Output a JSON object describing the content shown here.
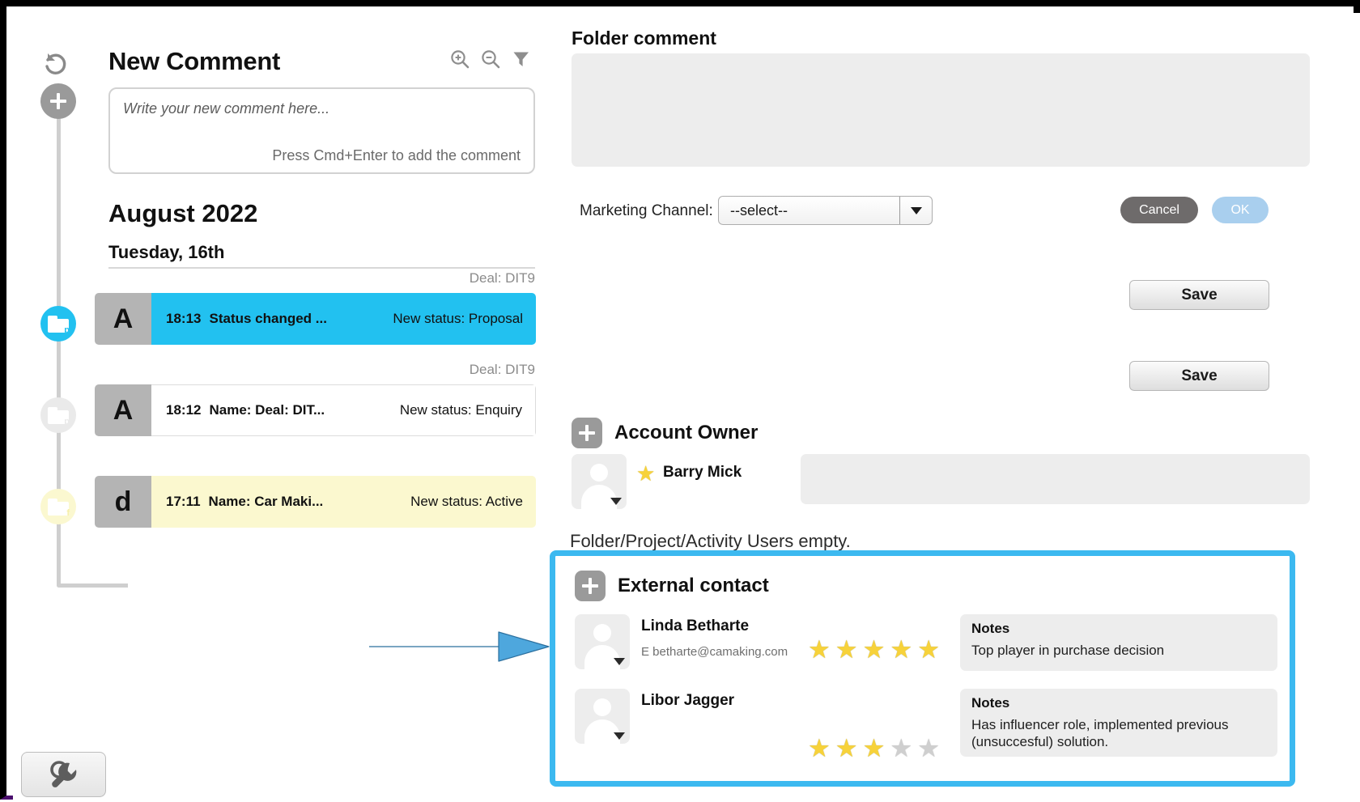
{
  "left_rail": {
    "undo_icon": "undo-icon",
    "add_icon": "plus-icon",
    "nodes": [
      {
        "name": "folder-p-active",
        "badge": "p"
      },
      {
        "name": "folder-p-inactive",
        "badge": "p"
      },
      {
        "name": "folder-f-inactive",
        "badge": "f"
      }
    ],
    "tool_icon": "wrench-icon"
  },
  "comment_panel": {
    "title": "New Comment",
    "icons": [
      "zoom-in-icon",
      "zoom-out-icon",
      "filter-icon"
    ],
    "input_placeholder": "Write your new comment here...",
    "hint": "Press Cmd+Enter to add the comment",
    "month": "August 2022",
    "day": "Tuesday, 16th",
    "events": [
      {
        "deal": "Deal: DIT9",
        "avatar": "A",
        "time": "18:13",
        "title": "Status changed ...",
        "status": "New status: Proposal",
        "style": "cyan"
      },
      {
        "deal": "Deal: DIT9",
        "avatar": "A",
        "time": "18:12",
        "title": "Name: Deal: DIT...",
        "status": "New status: Enquiry",
        "style": "white"
      },
      {
        "deal": "",
        "avatar": "d",
        "time": "17:11",
        "title": "Name: Car Maki...",
        "status": "New status: Active",
        "style": "yellow"
      }
    ]
  },
  "right_panel": {
    "folder_comment_title": "Folder comment",
    "folder_comment_value": "",
    "marketing_channel_label": "Marketing Channel:",
    "marketing_channel_value": "--select--",
    "cancel_label": "Cancel",
    "ok_label": "OK",
    "save_label_1": "Save",
    "save_label_2": "Save",
    "account_owner": {
      "section_title": "Account Owner",
      "owner_name": "Barry Mick",
      "owner_field_value": "",
      "star_icon": "star-icon"
    },
    "empty_note": "Folder/Project/Activity Users empty.",
    "external_contact": {
      "section_title": "External contact",
      "notes_label": "Notes",
      "contacts": [
        {
          "name": "Linda Betharte",
          "email": "E betharte@camaking.com",
          "rating": 5,
          "rating_max": 5,
          "notes_title": "Notes",
          "notes_text": "Top player in purchase decision"
        },
        {
          "name": "Libor Jagger",
          "email": "",
          "rating": 3,
          "rating_max": 5,
          "notes_title": "Notes",
          "notes_text": "Has influencer role, implemented previous (unsuccesful) solution."
        }
      ]
    }
  },
  "annotation": {
    "highlight_color": "#3cb9f0",
    "arrow_color": "#4ea7dd",
    "arrow_name": "callout-arrow"
  },
  "colors": {
    "accent_cyan": "#22c1f0",
    "highlight_blue": "#3cb9f0",
    "star_gold": "#f7d23a",
    "yellow_row": "#fbf8cf",
    "grey_chip": "#9a9a9a"
  }
}
